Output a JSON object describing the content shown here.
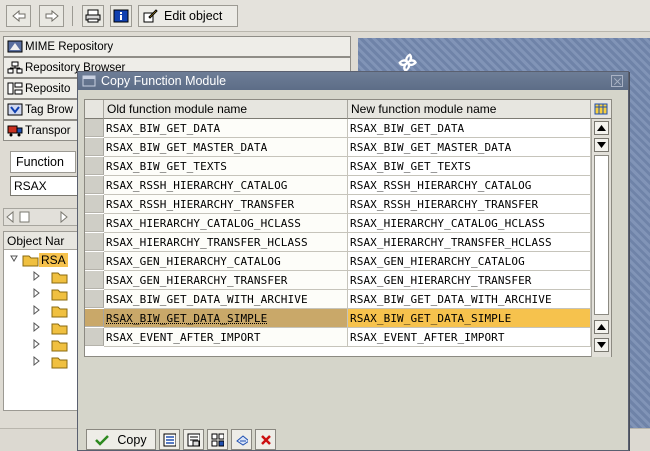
{
  "toolbar": {
    "back_icon": "arrow-left-icon",
    "forward_icon": "arrow-right-icon",
    "print_icon": "printer-icon",
    "info_icon": "info-icon",
    "edit_object_label": "Edit object"
  },
  "left_nav": {
    "items": [
      {
        "label": "MIME Repository",
        "icon": "mime-icon"
      },
      {
        "label": "Repository Browser",
        "icon": "tree-icon"
      },
      {
        "label": "Reposito",
        "icon": "repo-info-icon"
      },
      {
        "label": "Tag Brow",
        "icon": "tag-icon"
      },
      {
        "label": "Transpor",
        "icon": "truck-icon"
      }
    ],
    "function_label": "Function",
    "function_input_value": "RSAX",
    "tree_header": "Object Nar",
    "tree_root": "RSA"
  },
  "dialog": {
    "title": "Copy Function Module",
    "columns": {
      "old": "Old function module name",
      "new": "New function module name"
    },
    "rows": [
      {
        "old": "RSAX_BIW_GET_DATA",
        "new": "RSAX_BIW_GET_DATA"
      },
      {
        "old": "RSAX_BIW_GET_MASTER_DATA",
        "new": "RSAX_BIW_GET_MASTER_DATA"
      },
      {
        "old": "RSAX_BIW_GET_TEXTS",
        "new": "RSAX_BIW_GET_TEXTS"
      },
      {
        "old": "RSAX_RSSH_HIERARCHY_CATALOG",
        "new": "RSAX_RSSH_HIERARCHY_CATALOG"
      },
      {
        "old": "RSAX_RSSH_HIERARCHY_TRANSFER",
        "new": "RSAX_RSSH_HIERARCHY_TRANSFER"
      },
      {
        "old": "RSAX_HIERARCHY_CATALOG_HCLASS",
        "new": "RSAX_HIERARCHY_CATALOG_HCLASS"
      },
      {
        "old": "RSAX_HIERARCHY_TRANSFER_HCLASS",
        "new": "RSAX_HIERARCHY_TRANSFER_HCLASS"
      },
      {
        "old": "RSAX_GEN_HIERARCHY_CATALOG",
        "new": "RSAX_GEN_HIERARCHY_CATALOG"
      },
      {
        "old": "RSAX_GEN_HIERARCHY_TRANSFER",
        "new": "RSAX_GEN_HIERARCHY_TRANSFER"
      },
      {
        "old": "RSAX_BIW_GET_DATA_WITH_ARCHIVE",
        "new": "RSAX_BIW_GET_DATA_WITH_ARCHIVE"
      },
      {
        "old": "RSAX_BIW_GET_DATA_SIMPLE",
        "new": "RSAX_BIW_GET_DATA_SIMPLE"
      },
      {
        "old": "RSAX_EVENT_AFTER_IMPORT",
        "new": "RSAX_EVENT_AFTER_IMPORT"
      }
    ],
    "highlighted_row": 10,
    "buttons": {
      "copy_label": "Copy",
      "icons": [
        "select-all-icon",
        "deselect-all-icon",
        "find-icon",
        "refresh-icon",
        "cancel-icon"
      ]
    },
    "colors": {
      "title_bar": "#5d6d87",
      "highlight_new": "#f6c24d",
      "highlight_old": "#c9a869",
      "cancel_icon": "#cc1010",
      "copy_check": "#2d8a1f"
    }
  }
}
